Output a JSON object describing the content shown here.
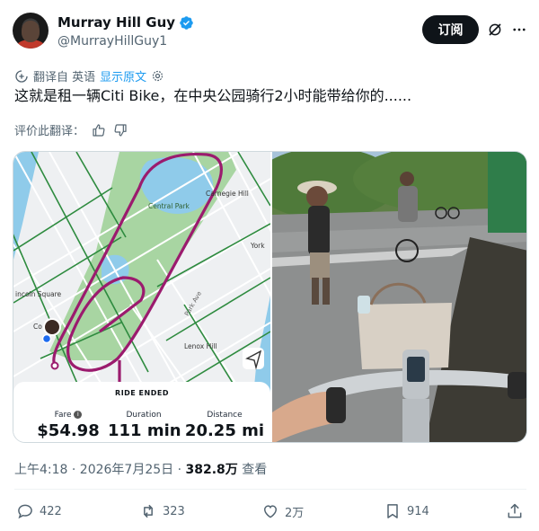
{
  "author": {
    "display_name": "Murray Hill Guy",
    "handle": "@MurrayHillGuy1",
    "verified_icon": "verified-badge-icon"
  },
  "header_actions": {
    "subscribe_label": "订阅",
    "grok_icon": "grok-icon",
    "more_icon": "more-options-icon"
  },
  "translation": {
    "translated_from": "翻译自 英语",
    "show_original": "显示原文",
    "settings_icon": "gear-icon"
  },
  "tweet": {
    "text": "这就是租一辆Citi Bike，在中央公园骑行2小时能带给你的......"
  },
  "rate_translation": {
    "label": "评价此翻译："
  },
  "media": {
    "map": {
      "labels": {
        "central_park": "Central Park",
        "carnegie_hill": "Carnegie Hill",
        "yorkville": "York",
        "lincoln_square": "incoln Square",
        "lenox_hill": "Lenox Hill",
        "park_ave": "Park Ave",
        "columbus": "Co"
      },
      "ride": {
        "status": "RIDE ENDED",
        "fare_label": "Fare",
        "fare_value": "$54.98",
        "duration_label": "Duration",
        "duration_value": "111 min",
        "distance_label": "Distance",
        "distance_value": "20.25 mi"
      },
      "colors": {
        "route": "#9b1b6e",
        "park": "#a8d5a2",
        "water": "#8fcbea",
        "bike_lane": "#2e8b3f"
      }
    },
    "photo": {
      "description_icon": "central-park-photo"
    }
  },
  "meta": {
    "timestamp": "上午4:18 · 2026年7月25日 · ",
    "views_count": "382.8万",
    "views_label": " 查看"
  },
  "actions": {
    "reply_count": "422",
    "retweet_count": "323",
    "like_count": "2万",
    "bookmark_count": "914"
  }
}
